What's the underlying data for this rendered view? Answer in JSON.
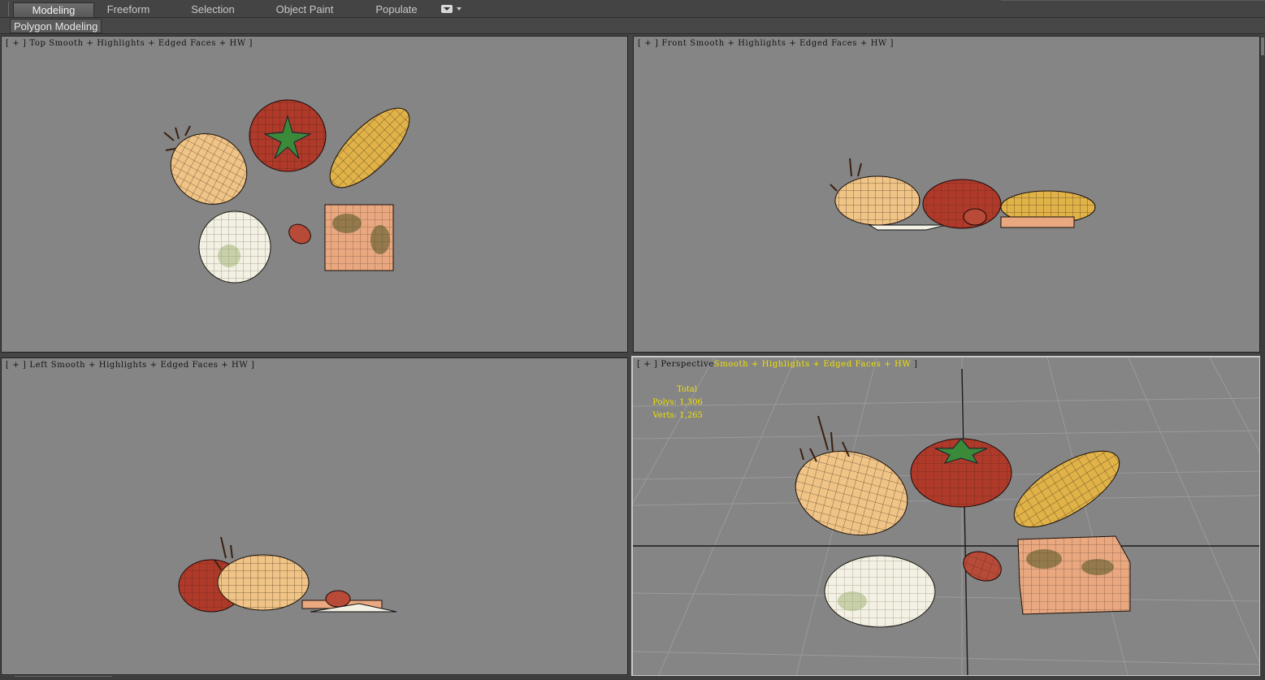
{
  "ribbon": {
    "tabs": [
      "Modeling",
      "Freeform",
      "Selection",
      "Object Paint",
      "Populate"
    ],
    "active_tab": "Modeling",
    "panel_label": "Polygon Modeling"
  },
  "viewports": {
    "top": {
      "bracket_open": "[ + ] ",
      "view": "Top",
      "shading": " Smooth + Highlights + Edged Faces + HW ]"
    },
    "front": {
      "bracket_open": "[ + ] ",
      "view": "Front",
      "shading": " Smooth + Highlights + Edged Faces + HW ]"
    },
    "left": {
      "bracket_open": "[ + ] ",
      "view": "Left",
      "shading": " Smooth + Highlights + Edged Faces + HW ]"
    },
    "perspective": {
      "bracket_open": "[ + ] ",
      "view": "Perspective",
      "shading_highlighted": "Smooth + Highlights + Edged Faces + HW",
      "bracket_close": " ]",
      "stats": {
        "total_label": "Total",
        "polys_label": "Polys:",
        "polys_value": "1,306",
        "verts_label": "Verts:",
        "verts_value": "1,265"
      }
    }
  },
  "colors": {
    "viewport_bg": "#858585",
    "ui_bg": "#444444",
    "active_border": "#c9c9c9",
    "stats_text": "#f0e000",
    "onion": "#f0c486",
    "tomato": "#b03a2a",
    "corn": "#e0b248",
    "plate": "#f3f1e3",
    "bread": "#e9a880"
  },
  "icons": [
    "tab-options-icon",
    "dropdown-arrow-icon"
  ]
}
